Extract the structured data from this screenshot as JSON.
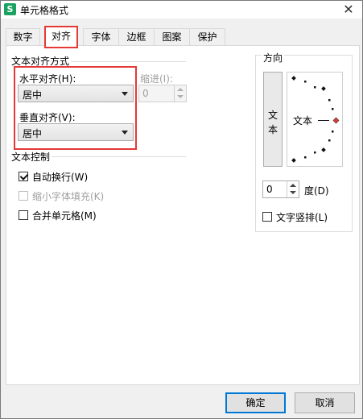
{
  "window": {
    "title": "单元格格式",
    "close": "✕",
    "icon_letter": "S"
  },
  "tabs": [
    "数字",
    "对齐",
    "字体",
    "边框",
    "图案",
    "保护"
  ],
  "alignment": {
    "section_title": "文本对齐方式",
    "horizontal_label": "水平对齐(H):",
    "horizontal_value": "居中",
    "indent_label": "缩进(I):",
    "indent_value": "0",
    "vertical_label": "垂直对齐(V):",
    "vertical_value": "居中"
  },
  "text_control": {
    "section_title": "文本控制",
    "wrap_text": {
      "label": "自动换行(W)",
      "checked": true
    },
    "shrink_to_fit": {
      "label": "缩小字体填充(K)",
      "checked": false,
      "disabled": true
    },
    "merge_cells": {
      "label": "合并单元格(M)",
      "checked": false
    }
  },
  "orientation": {
    "title": "方向",
    "vertical_text_chars": [
      "文",
      "本"
    ],
    "dial_text": "文本",
    "degree_value": "0",
    "degree_label": "度(D)",
    "vertical_text_option": "文字竖排(L)"
  },
  "buttons": {
    "ok": "确定",
    "cancel": "取消"
  },
  "colors": {
    "highlight": "#e53935",
    "default_button_border": "#0078d7",
    "app_icon": "#1aa260"
  }
}
